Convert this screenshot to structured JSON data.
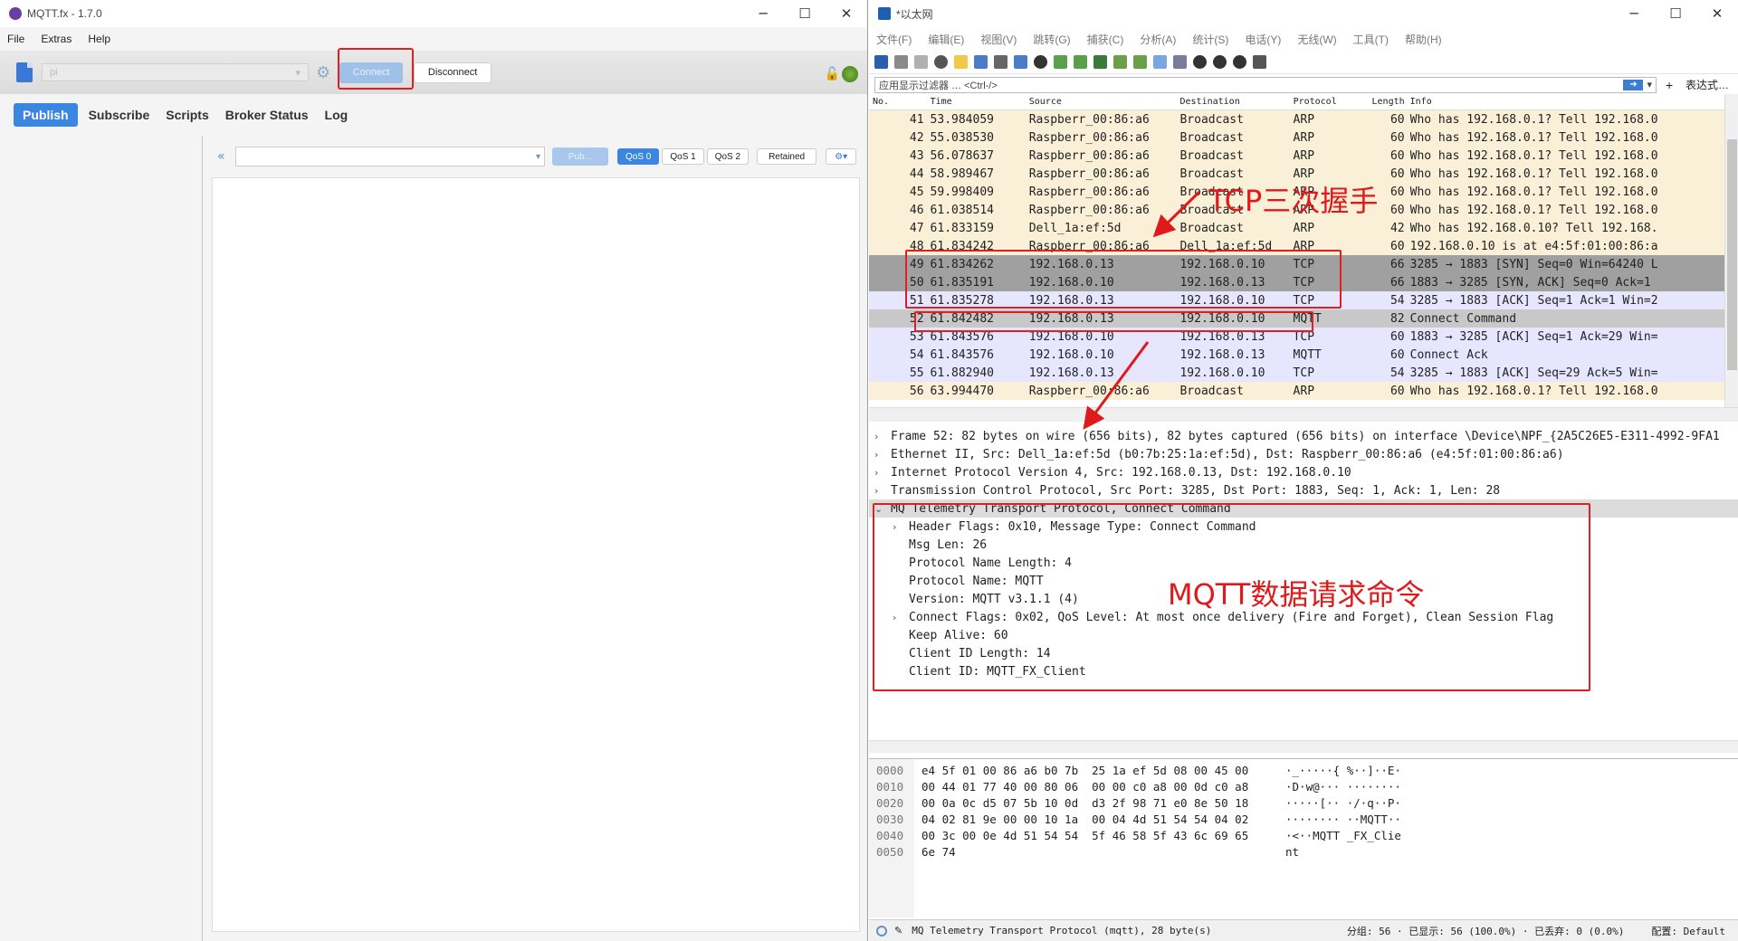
{
  "mqttfx": {
    "title": "MQTT.fx - 1.7.0",
    "menu": [
      "File",
      "Extras",
      "Help"
    ],
    "profile": "pi",
    "connect_label": "Connect",
    "disconnect_label": "Disconnect",
    "tabs": [
      "Publish",
      "Subscribe",
      "Scripts",
      "Broker Status",
      "Log"
    ],
    "publish_label": "Pub...",
    "qos": [
      "QoS 0",
      "QoS 1",
      "QoS 2"
    ],
    "retained_label": "Retained",
    "icons": {
      "new_profile": "document-icon",
      "settings": "gear-icon",
      "lock": "unlock-icon",
      "status": "connection-status-icon"
    },
    "colors": {
      "accent": "#3a86e0",
      "status": "#5c9a2b"
    }
  },
  "wireshark": {
    "title": "*以太网",
    "menu": [
      "文件(F)",
      "编辑(E)",
      "视图(V)",
      "跳转(G)",
      "捕获(C)",
      "分析(A)",
      "统计(S)",
      "电话(Y)",
      "无线(W)",
      "工具(T)",
      "帮助(H)"
    ],
    "filter_placeholder": "应用显示过滤器 … <Ctrl-/>",
    "filter_expression": "表达式…",
    "columns": [
      "No.",
      "Time",
      "Source",
      "Destination",
      "Protocol",
      "Length",
      "Info"
    ],
    "packets": [
      {
        "no": "41",
        "time": "53.984059",
        "src": "Raspberr_00:86:a6",
        "dst": "Broadcast",
        "proto": "ARP",
        "len": "60",
        "info": "Who has 192.168.0.1? Tell 192.168.0"
      },
      {
        "no": "42",
        "time": "55.038530",
        "src": "Raspberr_00:86:a6",
        "dst": "Broadcast",
        "proto": "ARP",
        "len": "60",
        "info": "Who has 192.168.0.1? Tell 192.168.0"
      },
      {
        "no": "43",
        "time": "56.078637",
        "src": "Raspberr_00:86:a6",
        "dst": "Broadcast",
        "proto": "ARP",
        "len": "60",
        "info": "Who has 192.168.0.1? Tell 192.168.0"
      },
      {
        "no": "44",
        "time": "58.989467",
        "src": "Raspberr_00:86:a6",
        "dst": "Broadcast",
        "proto": "ARP",
        "len": "60",
        "info": "Who has 192.168.0.1? Tell 192.168.0"
      },
      {
        "no": "45",
        "time": "59.998409",
        "src": "Raspberr_00:86:a6",
        "dst": "Broadcast",
        "proto": "ARP",
        "len": "60",
        "info": "Who has 192.168.0.1? Tell 192.168.0"
      },
      {
        "no": "46",
        "time": "61.038514",
        "src": "Raspberr_00:86:a6",
        "dst": "Broadcast",
        "proto": "ARP",
        "len": "60",
        "info": "Who has 192.168.0.1? Tell 192.168.0"
      },
      {
        "no": "47",
        "time": "61.833159",
        "src": "Dell_1a:ef:5d",
        "dst": "Broadcast",
        "proto": "ARP",
        "len": "42",
        "info": "Who has 192.168.0.10? Tell 192.168."
      },
      {
        "no": "48",
        "time": "61.834242",
        "src": "Raspberr_00:86:a6",
        "dst": "Dell_1a:ef:5d",
        "proto": "ARP",
        "len": "60",
        "info": "192.168.0.10 is at e4:5f:01:00:86:a"
      },
      {
        "no": "49",
        "time": "61.834262",
        "src": "192.168.0.13",
        "dst": "192.168.0.10",
        "proto": "TCP",
        "len": "66",
        "info": "3285 → 1883 [SYN] Seq=0 Win=64240 L"
      },
      {
        "no": "50",
        "time": "61.835191",
        "src": "192.168.0.10",
        "dst": "192.168.0.13",
        "proto": "TCP",
        "len": "66",
        "info": "1883 → 3285 [SYN, ACK] Seq=0 Ack=1"
      },
      {
        "no": "51",
        "time": "61.835278",
        "src": "192.168.0.13",
        "dst": "192.168.0.10",
        "proto": "TCP",
        "len": "54",
        "info": "3285 → 1883 [ACK] Seq=1 Ack=1 Win=2"
      },
      {
        "no": "52",
        "time": "61.842482",
        "src": "192.168.0.13",
        "dst": "192.168.0.10",
        "proto": "MQTT",
        "len": "82",
        "info": "Connect Command"
      },
      {
        "no": "53",
        "time": "61.843576",
        "src": "192.168.0.10",
        "dst": "192.168.0.13",
        "proto": "TCP",
        "len": "60",
        "info": "1883 → 3285 [ACK] Seq=1 Ack=29 Win="
      },
      {
        "no": "54",
        "time": "61.843576",
        "src": "192.168.0.10",
        "dst": "192.168.0.13",
        "proto": "MQTT",
        "len": "60",
        "info": "Connect Ack"
      },
      {
        "no": "55",
        "time": "61.882940",
        "src": "192.168.0.13",
        "dst": "192.168.0.10",
        "proto": "TCP",
        "len": "54",
        "info": "3285 → 1883 [ACK] Seq=29 Ack=5 Win="
      },
      {
        "no": "56",
        "time": "63.994470",
        "src": "Raspberr_00:86:a6",
        "dst": "Broadcast",
        "proto": "ARP",
        "len": "60",
        "info": "Who has 192.168.0.1? Tell 192.168.0"
      }
    ],
    "details": [
      "Frame 52: 82 bytes on wire (656 bits), 82 bytes captured (656 bits) on interface \\Device\\NPF_{2A5C26E5-E311-4992-9FA1",
      "Ethernet II, Src: Dell_1a:ef:5d (b0:7b:25:1a:ef:5d), Dst: Raspberr_00:86:a6 (e4:5f:01:00:86:a6)",
      "Internet Protocol Version 4, Src: 192.168.0.13, Dst: 192.168.0.10",
      "Transmission Control Protocol, Src Port: 3285, Dst Port: 1883, Seq: 1, Ack: 1, Len: 28",
      "MQ Telemetry Transport Protocol, Connect Command"
    ],
    "mqtt_fields": [
      "Header Flags: 0x10, Message Type: Connect Command",
      "Msg Len: 26",
      "Protocol Name Length: 4",
      "Protocol Name: MQTT",
      "Version: MQTT v3.1.1 (4)",
      "Connect Flags: 0x02, QoS Level: At most once delivery (Fire and Forget), Clean Session Flag",
      "Keep Alive: 60",
      "Client ID Length: 14",
      "Client ID: MQTT_FX_Client"
    ],
    "hex": [
      {
        "off": "0000",
        "bytes": "e4 5f 01 00 86 a6 b0 7b  25 1a ef 5d 08 00 45 00",
        "ascii": "·_·····{ %··]··E·"
      },
      {
        "off": "0010",
        "bytes": "00 44 01 77 40 00 80 06  00 00 c0 a8 00 0d c0 a8",
        "ascii": "·D·w@··· ········"
      },
      {
        "off": "0020",
        "bytes": "00 0a 0c d5 07 5b 10 0d  d3 2f 98 71 e0 8e 50 18",
        "ascii": "·····[·· ·/·q··P·"
      },
      {
        "off": "0030",
        "bytes": "04 02 81 9e 00 00 10 1a  00 04 4d 51 54 54 04 02",
        "ascii": "········ ··MQTT··"
      },
      {
        "off": "0040",
        "bytes": "00 3c 00 0e 4d 51 54 54  5f 46 58 5f 43 6c 69 65",
        "ascii": "·<··MQTT _FX_Clie"
      },
      {
        "off": "0050",
        "bytes": "6e 74",
        "ascii": "nt"
      }
    ],
    "status_protocol": "MQ Telemetry Transport Protocol (mqtt), 28 byte(s)",
    "status_stats": "分组: 56 · 已显示: 56 (100.0%) · 已丢弃: 0 (0.0%)",
    "status_profile": "配置: Default",
    "annotations": {
      "handshake": "TCP三次握手",
      "request": "MQTT数据请求命令"
    },
    "colors": {
      "arp_row": "#faf0d7",
      "tcp_row": "#e7e6ff",
      "annotation": "#e0191b"
    }
  }
}
